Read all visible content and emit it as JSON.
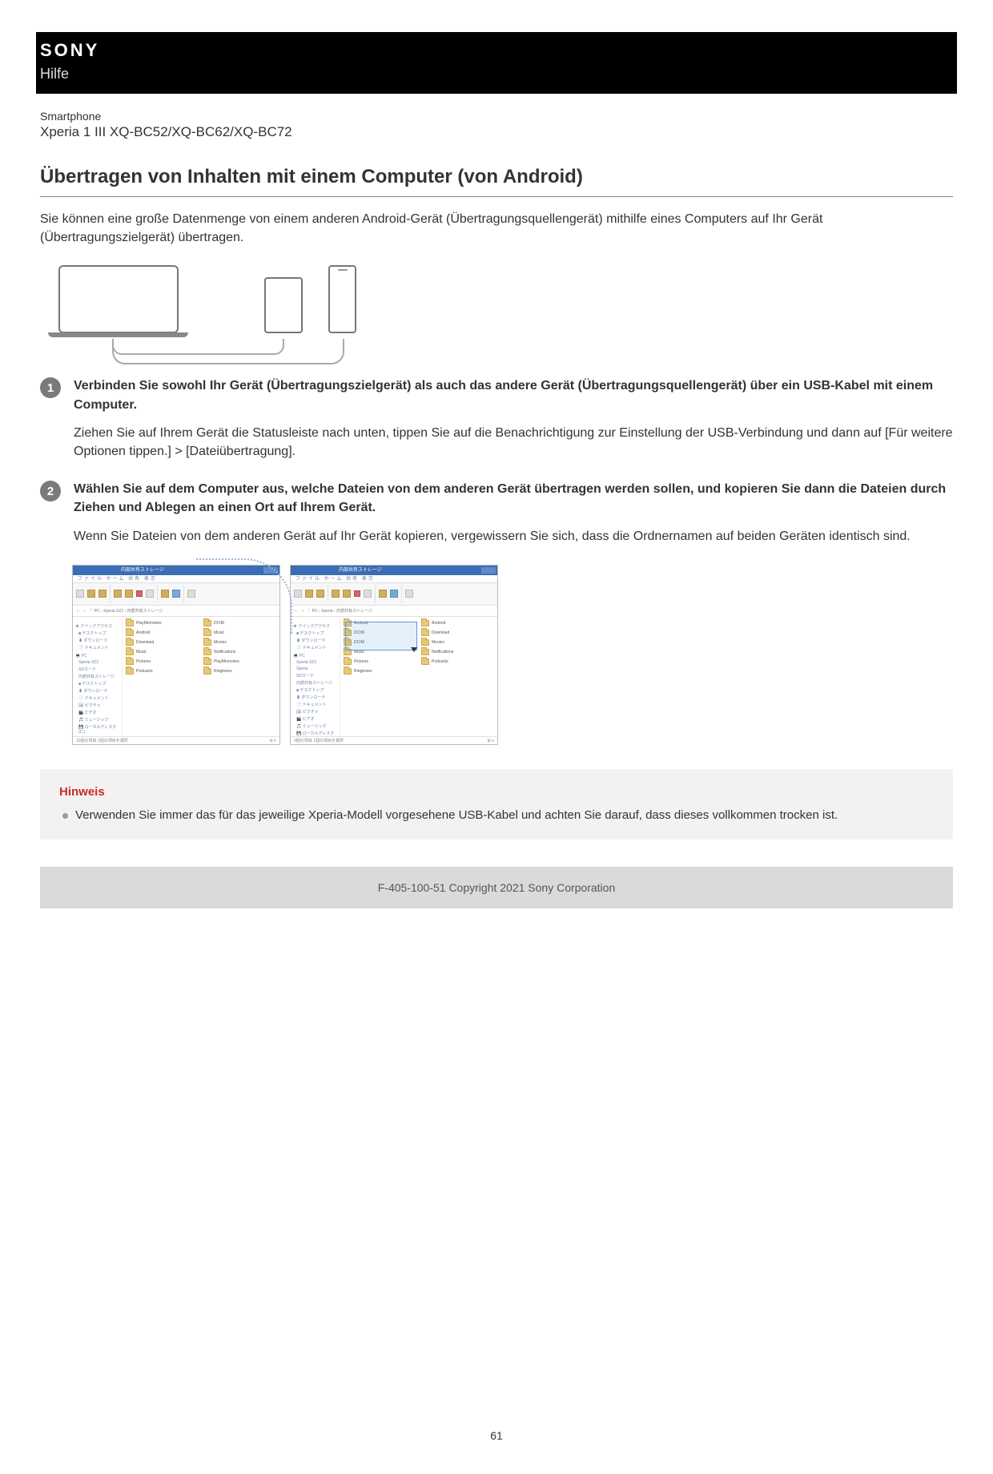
{
  "header": {
    "brand": "SONY",
    "help": "Hilfe"
  },
  "meta": {
    "product_type": "Smartphone",
    "product_model": "Xperia 1 III XQ-BC52/XQ-BC62/XQ-BC72"
  },
  "title": "Übertragen von Inhalten mit einem Computer (von Android)",
  "intro": "Sie können eine große Datenmenge von einem anderen Android-Gerät (Übertragungsquellengerät) mithilfe eines Computers auf Ihr Gerät (Übertragungszielgerät) übertragen.",
  "steps": [
    {
      "num": "1",
      "title": "Verbinden Sie sowohl Ihr Gerät (Übertragungszielgerät) als auch das andere Gerät (Übertragungsquellengerät) über ein USB-Kabel mit einem Computer.",
      "desc": "Ziehen Sie auf Ihrem Gerät die Statusleiste nach unten, tippen Sie auf die Benachrichtigung zur Einstellung der USB-Verbindung und dann auf [Für weitere Optionen tippen.] > [Dateiübertragung]."
    },
    {
      "num": "2",
      "title": "Wählen Sie auf dem Computer aus, welche Dateien von dem anderen Gerät übertragen werden sollen, und kopieren Sie dann die Dateien durch Ziehen und Ablegen an einen Ort auf Ihrem Gerät.",
      "desc": "Wenn Sie Dateien von dem anderen Gerät auf Ihr Gerät kopieren, vergewissern Sie sich, dass die Ordnernamen auf beiden Geräten identisch sind."
    }
  ],
  "figure_fm": {
    "window_title": "内部共有ストレージ",
    "folders_left": [
      "PlayMemories",
      "Android",
      "Download",
      "Music",
      "Pictures",
      "Podcasts",
      "Movies",
      "Ringtones",
      "DCIM",
      "Notifications"
    ],
    "folders_right": [
      "Android",
      "DCIM",
      "Download",
      "Movies",
      "Music",
      "Notifications",
      "Pictures",
      "Podcasts",
      "Ringtones"
    ],
    "status_left": "10個の項目  1個の項目を選択",
    "status_right": "9個の項目  1個の項目を選択"
  },
  "note": {
    "heading": "Hinweis",
    "items": [
      "Verwenden Sie immer das für das jeweilige Xperia-Modell vorgesehene USB-Kabel und achten Sie darauf, dass dieses vollkommen trocken ist."
    ]
  },
  "footer": "F-405-100-51 Copyright 2021 Sony Corporation",
  "page_number": "61"
}
